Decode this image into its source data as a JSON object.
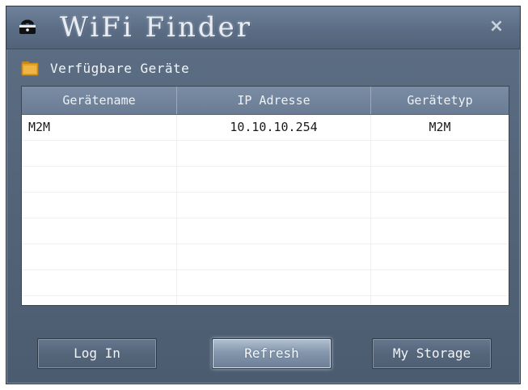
{
  "window": {
    "title": "WiFi Finder",
    "close_glyph": "×"
  },
  "section": {
    "label": "Verfügbare Geräte",
    "icon": "folder-icon"
  },
  "table": {
    "headers": [
      "Gerätename",
      "IP Adresse",
      "Gerätetyp"
    ],
    "rows": [
      [
        "M2M",
        "10.10.10.254",
        "M2M"
      ]
    ]
  },
  "buttons": {
    "login": "Log In",
    "refresh": "Refresh",
    "storage": "My Storage"
  },
  "colors": {
    "window_bg": "#54657a",
    "header_bg": "#6a7c93",
    "folder": "#e3a126"
  }
}
